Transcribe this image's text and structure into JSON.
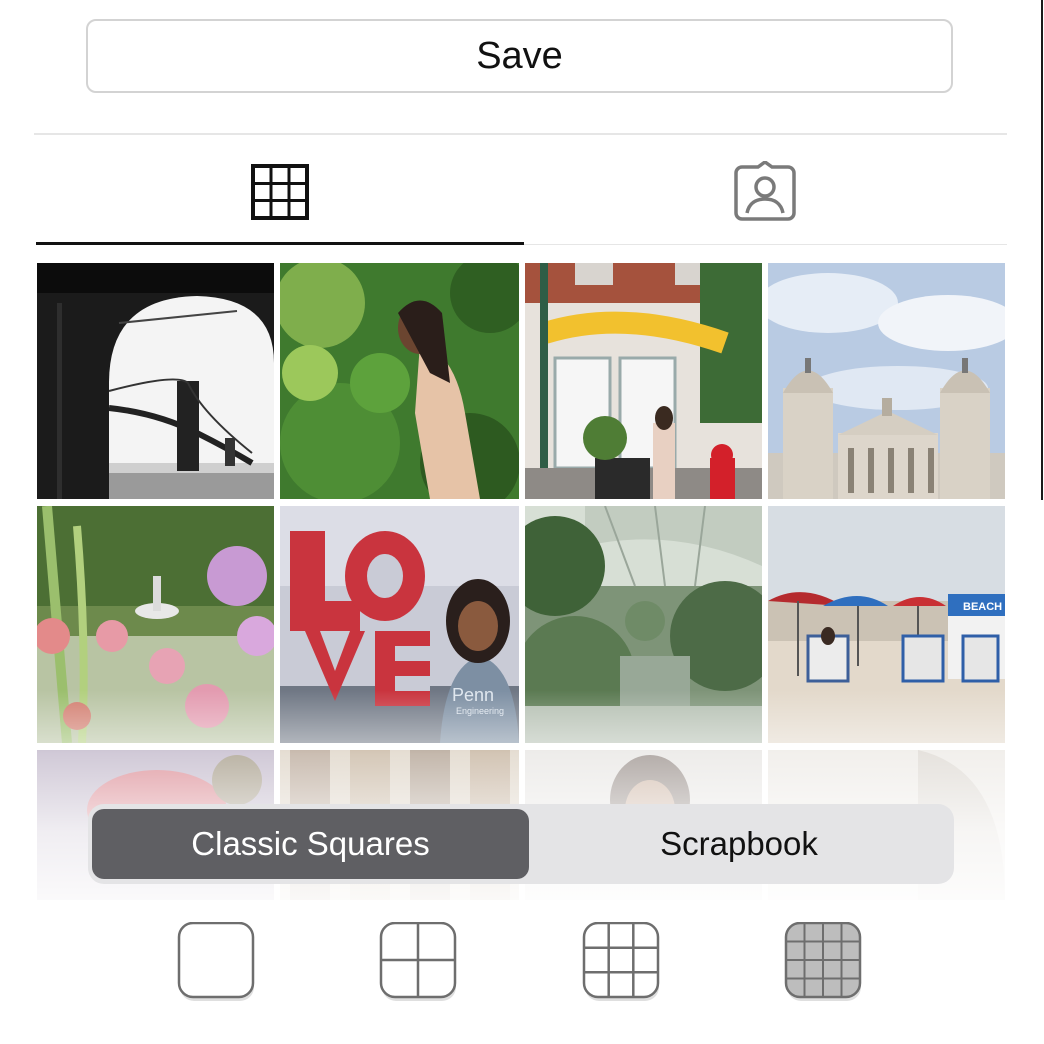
{
  "header": {
    "save_label": "Save"
  },
  "tabs": [
    {
      "name": "grid",
      "icon": "grid-icon",
      "selected": true
    },
    {
      "name": "tagged",
      "icon": "tagged-person-icon",
      "selected": false
    }
  ],
  "photos": [
    {
      "subject": "Black and white bridge through arch"
    },
    {
      "subject": "Woman among green leaves"
    },
    {
      "subject": "Storefront with yellow flowers and red hydrant"
    },
    {
      "subject": "Cathedral with twin towers under sky"
    },
    {
      "subject": "Garden with pink coneflowers and fountain"
    },
    {
      "subject": "Woman in front of red LOVE sculpture"
    },
    {
      "subject": "Greenhouse conservatory with palms"
    },
    {
      "subject": "Beach with red and blue umbrellas and chairs"
    }
  ],
  "photo_texts": {
    "beach_sign": "BEACH",
    "shirt": "Penn\nEngineering"
  },
  "segmented_control": {
    "options": [
      "Classic Squares",
      "Scrapbook"
    ],
    "selected": "Classic Squares"
  },
  "layout_options": [
    {
      "icon": "single-square-icon",
      "grid": 1
    },
    {
      "icon": "two-by-two-grid-icon",
      "grid": 2
    },
    {
      "icon": "three-by-three-grid-icon",
      "grid": 3
    },
    {
      "icon": "four-by-four-grid-icon",
      "grid": 4,
      "selected": true
    }
  ],
  "colors": {
    "segment_selected": "#5f5f63",
    "segment_bg": "#e4e4e6",
    "tab_active": "#111111"
  }
}
